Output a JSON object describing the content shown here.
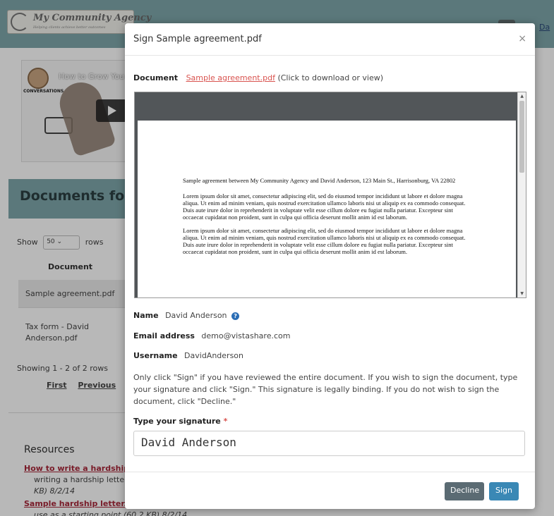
{
  "background": {
    "brand": {
      "name": "My Community Agency",
      "tagline": "Helping clients achieve better outcomes"
    },
    "top_link": "Da",
    "video": {
      "title": "How to Grow You",
      "label": "CONVERSATIONS"
    },
    "docs_title": "Documents for S",
    "table": {
      "show_label": "Show",
      "rows_label": "rows",
      "rows_value": "50",
      "column_document": "Document",
      "rows": [
        "Sample agreement.pdf",
        "Tax form - David Anderson.pdf"
      ],
      "showing": "Showing 1 - 2 of 2 rows",
      "pager": {
        "first": "First",
        "previous": "Previous"
      }
    },
    "resources": {
      "title": "Resources",
      "items": [
        {
          "link": "How to write a hardship le",
          "text": "writing a hardship letter t",
          "meta": "KB) 8/2/14"
        },
        {
          "link": "Sample hardship letter.pdf",
          "text": "use as a starting point (60.2 KB) 8/2/14"
        }
      ]
    }
  },
  "modal": {
    "title": "Sign Sample agreement.pdf",
    "close": "×",
    "document_label": "Document",
    "document_link": "Sample agreement.pdf",
    "document_hint": "(Click to download or view)",
    "pdf": {
      "intro": "Sample agreement between My Community Agency and David Anderson, 123 Main St., Harrisonburg, VA  22802",
      "paragraphs": [
        "Lorem ipsum dolor sit amet, consectetur adipiscing elit, sed do eiusmod tempor incididunt ut labore et dolore magna aliqua. Ut enim ad minim veniam, quis nostrud exercitation ullamco laboris nisi ut aliquip ex ea commodo consequat. Duis aute irure dolor in reprehenderit in voluptate velit esse cillum dolore eu fugiat nulla pariatur. Excepteur sint occaecat cupidatat non proident, sunt in culpa qui officia deserunt mollit anim id est laborum.",
        "Lorem ipsum dolor sit amet, consectetur adipiscing elit, sed do eiusmod tempor incididunt ut labore et dolore magna aliqua. Ut enim ad minim veniam, quis nostrud exercitation ullamco laboris nisi ut aliquip ex ea commodo consequat. Duis aute irure dolor in reprehenderit in voluptate velit esse cillum dolore eu fugiat nulla pariatur. Excepteur sint occaecat cupidatat non proident, sunt in culpa qui officia deserunt mollit anim id est laborum."
      ]
    },
    "name_label": "Name",
    "name_value": "David Anderson",
    "email_label": "Email address",
    "email_value": "demo@vistashare.com",
    "username_label": "Username",
    "username_value": "DavidAnderson",
    "instructions": "Only click \"Sign\" if you have reviewed the entire document. If you wish to sign the document, type your signature and click \"Sign.\" This signature is legally binding. If you do not wish to sign the document, click \"Decline.\"",
    "signature_label": "Type your signature",
    "signature_required": "*",
    "signature_value": "David Anderson",
    "decline_label": "Decline",
    "sign_label": "Sign"
  },
  "colors": {
    "brand_teal": "#7fa7ab",
    "link_red": "#d9534f",
    "sign_blue": "#3a88b5",
    "decline_gray": "#5b6b73"
  }
}
